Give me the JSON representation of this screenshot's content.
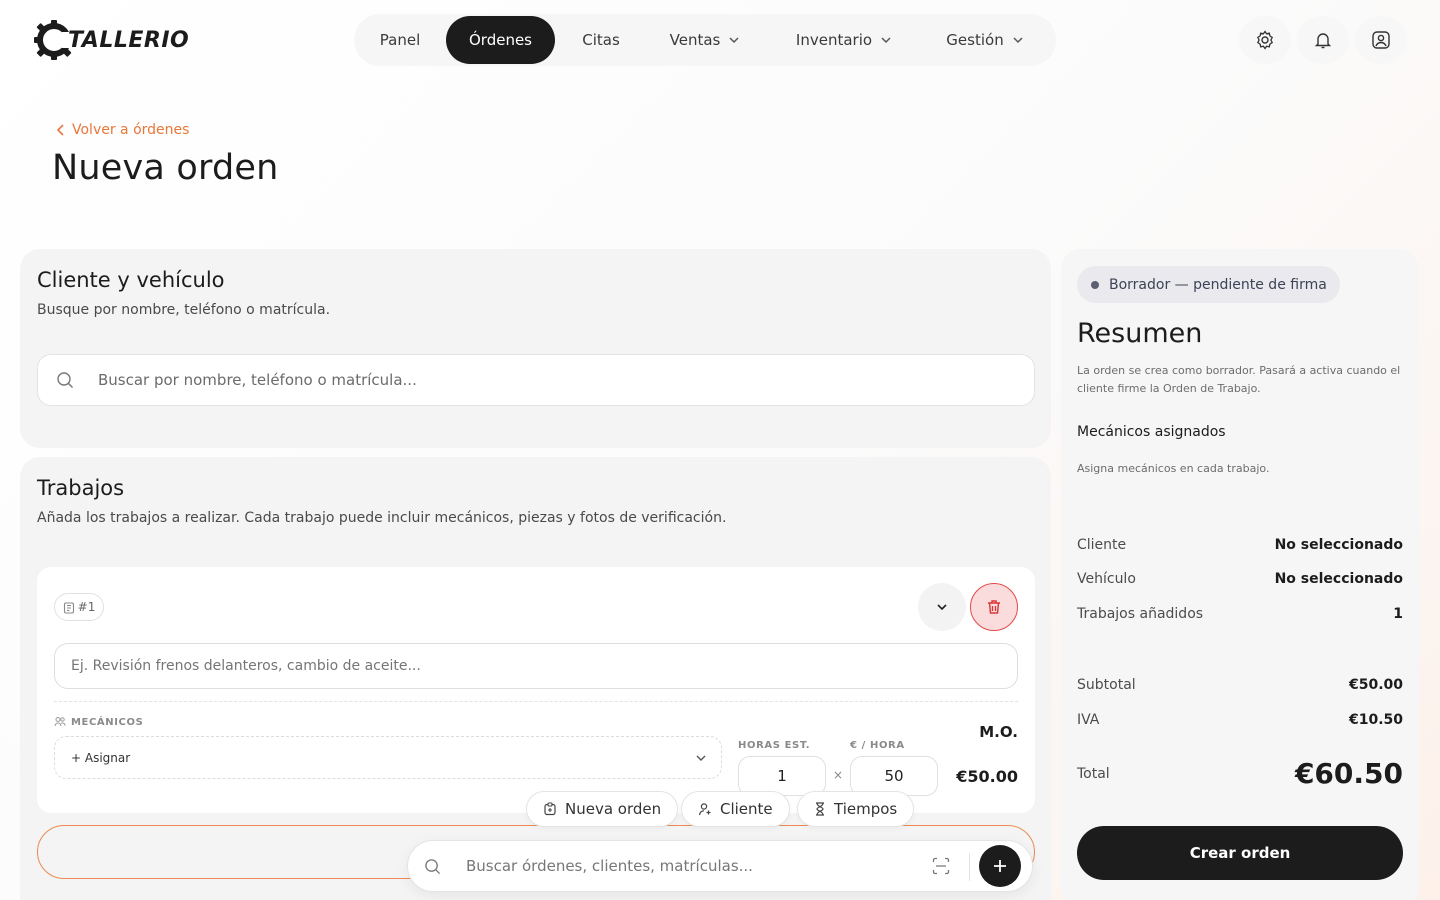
{
  "app": {
    "logo_text": "TALLERIO",
    "accent": "#e8773a",
    "dark": "#1c1c1c"
  },
  "nav": {
    "items": [
      {
        "label": "Panel"
      },
      {
        "label": "Órdenes",
        "active": true
      },
      {
        "label": "Citas"
      },
      {
        "label": "Ventas",
        "dropdown": true
      },
      {
        "label": "Inventario",
        "dropdown": true
      },
      {
        "label": "Gestión",
        "dropdown": true
      }
    ],
    "icons": [
      "gear-icon",
      "bell-icon",
      "user-icon"
    ]
  },
  "page": {
    "back_label": "Volver a órdenes",
    "title": "Nueva orden"
  },
  "client_card": {
    "title": "Cliente y vehículo",
    "subtitle": "Busque por nombre, teléfono o matrícula.",
    "search_placeholder": "Buscar por nombre, teléfono o matrícula..."
  },
  "jobs_card": {
    "title": "Trabajos",
    "subtitle": "Añada los trabajos a realizar. Cada trabajo puede incluir mecánicos, piezas y fotos de verificación.",
    "job": {
      "tag": "#1",
      "description_placeholder": "Ej. Revisión frenos delanteros, cambio de aceite...",
      "mechanics_label": "MECÁNICOS",
      "assign_label": "+ Asignar",
      "hours_label": "HORAS EST.",
      "rate_label": "€ / HORA",
      "hours_value": "1",
      "times_sign": "×",
      "rate_value": "50",
      "labor_label": "M.O.",
      "labor_total": "€50.00"
    }
  },
  "quick_actions": [
    {
      "label": "Nueva orden",
      "icon": "clipboard-icon"
    },
    {
      "label": "Cliente",
      "icon": "user-add-icon"
    },
    {
      "label": "Tiempos",
      "icon": "hourglass-icon"
    }
  ],
  "command_bar": {
    "placeholder": "Buscar órdenes, clientes, matrículas..."
  },
  "summary": {
    "status": "Borrador — pendiente de firma",
    "title": "Resumen",
    "note": "La orden se crea como borrador. Pasará a activa cuando el cliente firme la Orden de Trabajo.",
    "mechanics_heading": "Mecánicos asignados",
    "mechanics_hint": "Asigna mecánicos en cada trabajo.",
    "rows": [
      {
        "label": "Cliente",
        "value": "No seleccionado"
      },
      {
        "label": "Vehículo",
        "value": "No seleccionado"
      },
      {
        "label": "Trabajos añadidos",
        "value": "1"
      }
    ],
    "subtotal_label": "Subtotal",
    "subtotal_value": "€50.00",
    "iva_label": "IVA",
    "iva_value": "€10.50",
    "total_label": "Total",
    "total_value": "€60.50",
    "create_button": "Crear orden"
  }
}
